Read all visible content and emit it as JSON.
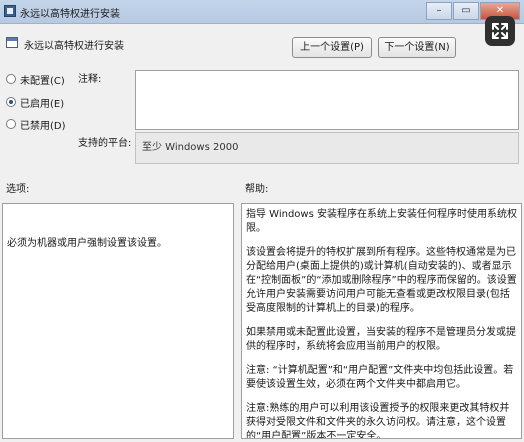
{
  "window": {
    "title": "永远以高特权进行安装",
    "minimize_glyph": "–",
    "maximize_glyph": "▭",
    "close_glyph": "✕"
  },
  "header": {
    "policy_name": "永远以高特权进行安装",
    "prev_button": "上一个设置(P)",
    "next_button": "下一个设置(N)"
  },
  "state": {
    "options": [
      {
        "label": "未配置(C)",
        "selected": false
      },
      {
        "label": "已启用(E)",
        "selected": true
      },
      {
        "label": "已禁用(D)",
        "selected": false
      }
    ]
  },
  "comment": {
    "label": "注释:",
    "value": ""
  },
  "platform": {
    "label": "支持的平台:",
    "value": "至少 Windows 2000"
  },
  "sections": {
    "options_label": "选项:",
    "help_label": "帮助:"
  },
  "options_text": "必须为机器或用户强制设置该设置。",
  "help_paragraphs": [
    "指导 Windows 安装程序在系统上安装任何程序时使用系统权限。",
    "该设置会将提升的特权扩展到所有程序。这些特权通常是为已分配给用户(桌面上提供的)或计算机(自动安装的)、或者显示在“控制面板”的“添加或删除程序”中的程序而保留的。该设置允许用户安装需要访问用户可能无查看或更改权限目录(包括受高度限制的计算机上的目录)的程序。",
    "如果禁用或未配置此设置，当安装的程序不是管理员分发或提供的程序时，系统将会应用当前用户的权限。",
    "注意: “计算机配置”和“用户配置”文件夹中均包括此设置。若要使该设置生效，必须在两个文件夹中都启用它。",
    "注意:熟练的用户可以利用该设置授予的权限来更改其特权并获得对受限文件和文件夹的永久访问权。请注意，这个设置的“用户配置”版本不一定安全。"
  ],
  "colors": {
    "selected_radio": "#2b4e86",
    "titlebar": "#b6c9e2",
    "close_button": "#c8553e"
  }
}
